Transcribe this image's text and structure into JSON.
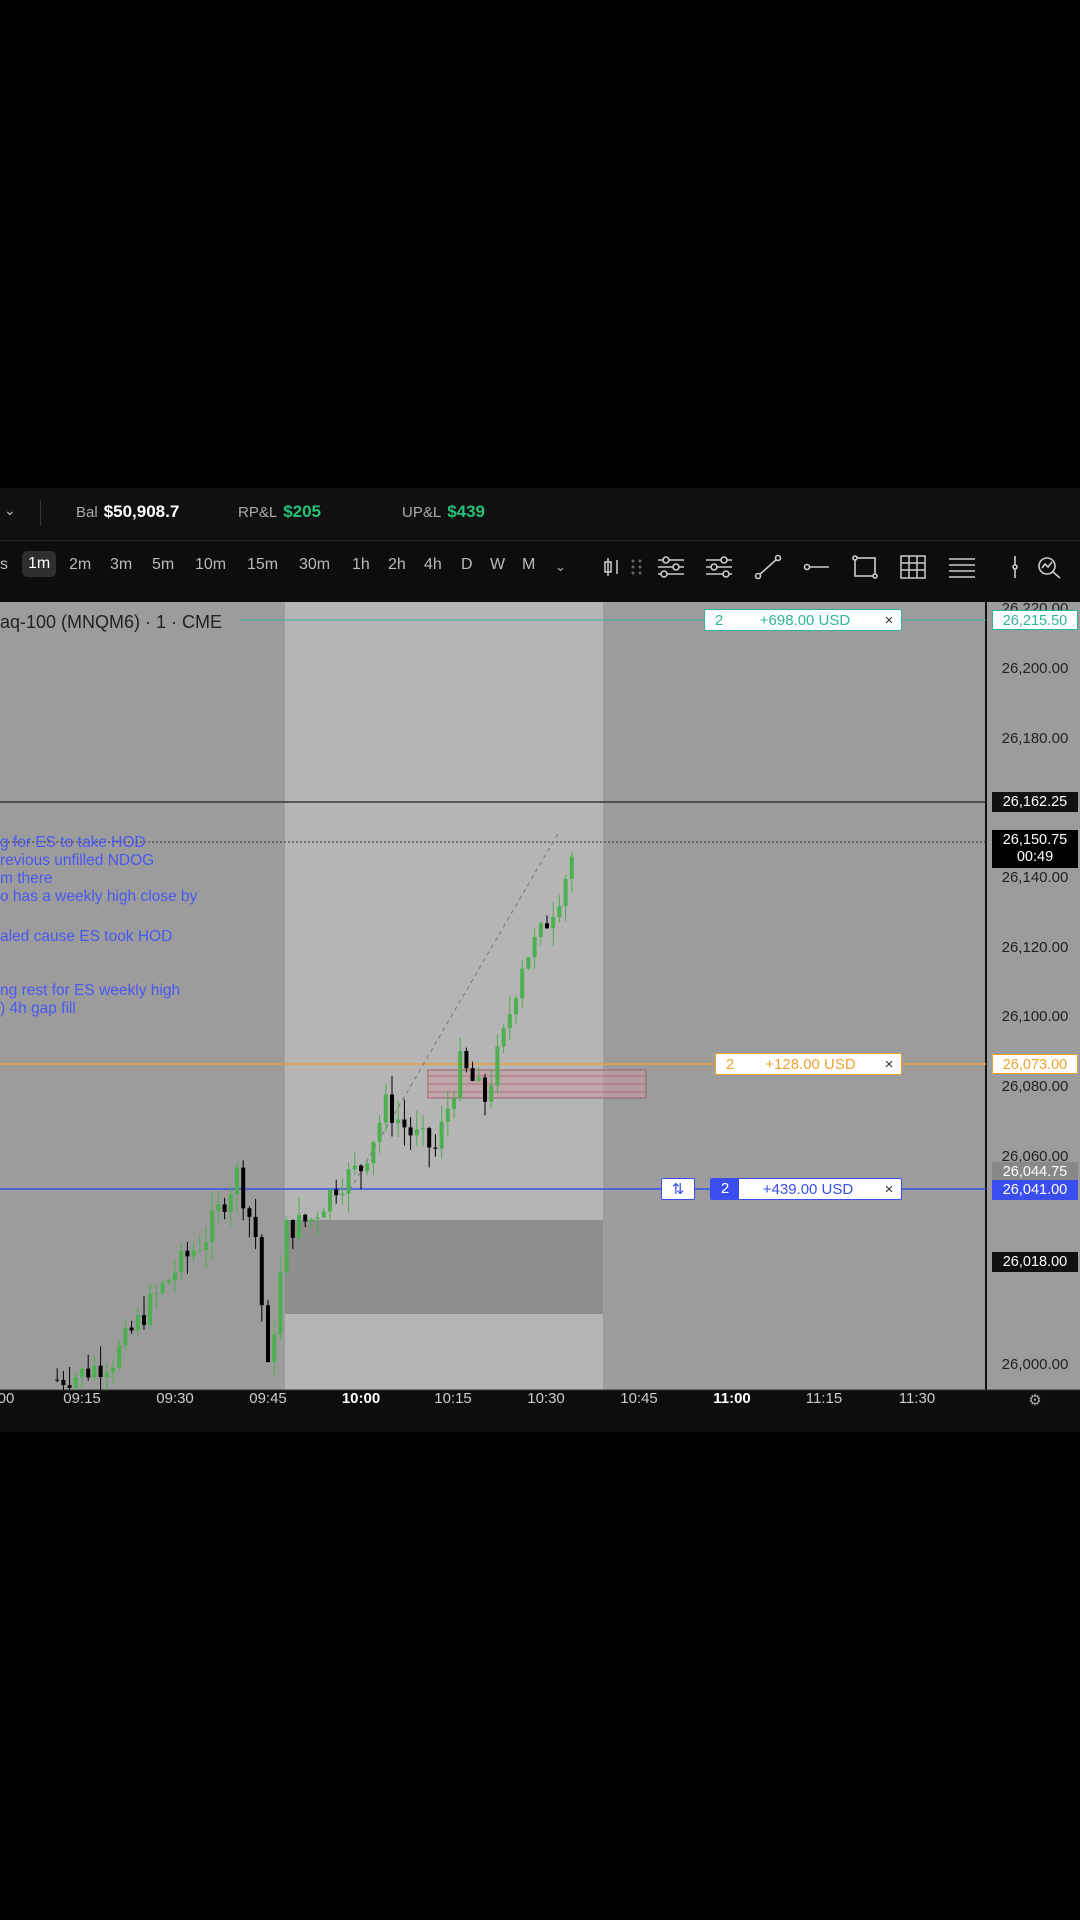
{
  "account": {
    "balance_label": "Bal",
    "balance_value": "$50,908.7",
    "rpnl_label": "RP&L",
    "rpnl_value": "$205",
    "upnl_label": "UP&L",
    "upnl_value": "$439",
    "positive_color": "#27c27a"
  },
  "toolbar": {
    "timeframes": [
      "s",
      "1m",
      "2m",
      "3m",
      "5m",
      "10m",
      "15m",
      "30m",
      "1h",
      "2h",
      "4h",
      "D",
      "W",
      "M"
    ],
    "active_timeframe": "1m",
    "tools": [
      "candle-type-icon",
      "drag-handle-icon",
      "indicators-icon",
      "settings-lines-icon",
      "trendline-icon",
      "horizontal-ray-icon",
      "rectangle-icon",
      "grid-icon",
      "menu-icon",
      "vertical-line-icon",
      "search-zoom-icon"
    ]
  },
  "chart": {
    "title": "aq-100 (MNQM6) · 1 · CME",
    "notes": [
      "g for ES to take HOD",
      "revious unfilled NDOG",
      "m there",
      "o has a weekly high close by",
      "aled cause ES took HOD",
      "ng rest for ES weekly high",
      ") 4h gap fill"
    ],
    "orders": [
      {
        "qty": "2",
        "pnl": "+698.00 USD",
        "close": "×",
        "price": "26,215.50",
        "color": "#2fb59a"
      },
      {
        "qty": "2",
        "pnl": "+128.00 USD",
        "close": "×",
        "price": "26,073.00",
        "color": "#f0a030"
      },
      {
        "qty": "2",
        "pnl": "+439.00 USD",
        "close": "×",
        "price": "26,041.00",
        "color": "#3a4ef0",
        "reverse": "⇅"
      }
    ],
    "price_labels": {
      "crosshair": "26,162.25",
      "last": "26,150.75",
      "countdown": "00:49",
      "level_gray": "26,044.75",
      "level_black": "26,018.00"
    },
    "y_ticks": [
      "26,220.00",
      "26,200.00",
      "26,180.00",
      "26,140.00",
      "26,120.00",
      "26,100.00",
      "26,080.00",
      "26,060.00",
      "26,000.00"
    ],
    "x_ticks": [
      "00",
      "09:15",
      "09:30",
      "09:45",
      "10:00",
      "10:15",
      "10:30",
      "10:45",
      "11:00",
      "11:15",
      "11:30"
    ],
    "bold_x_ticks": [
      "10:00",
      "11:00"
    ],
    "up_color": "#4caf50",
    "down_color": "#000000"
  },
  "chart_data": {
    "type": "candlestick",
    "symbol": "MNQM6",
    "interval": "1m",
    "ylim": [
      25995,
      26225
    ],
    "last_price": 26150.75,
    "candles_close_approx": [
      {
        "t": "09:11",
        "c": 25998
      },
      {
        "t": "09:15",
        "c": 26000
      },
      {
        "t": "09:20",
        "c": 26004
      },
      {
        "t": "09:26",
        "c": 26020
      },
      {
        "t": "09:30",
        "c": 26030
      },
      {
        "t": "09:35",
        "c": 26040
      },
      {
        "t": "09:40",
        "c": 26058
      },
      {
        "t": "09:43",
        "c": 26040
      },
      {
        "t": "09:45",
        "c": 26000
      },
      {
        "t": "09:48",
        "c": 26042
      },
      {
        "t": "09:52",
        "c": 26045
      },
      {
        "t": "09:56",
        "c": 26055
      },
      {
        "t": "10:00",
        "c": 26060
      },
      {
        "t": "10:04",
        "c": 26078
      },
      {
        "t": "10:08",
        "c": 26070
      },
      {
        "t": "10:12",
        "c": 26065
      },
      {
        "t": "10:16",
        "c": 26090
      },
      {
        "t": "10:20",
        "c": 26080
      },
      {
        "t": "10:23",
        "c": 26098
      },
      {
        "t": "10:26",
        "c": 26120
      },
      {
        "t": "10:29",
        "c": 26128
      },
      {
        "t": "10:32",
        "c": 26140
      },
      {
        "t": "10:34",
        "c": 26150.75
      }
    ]
  }
}
